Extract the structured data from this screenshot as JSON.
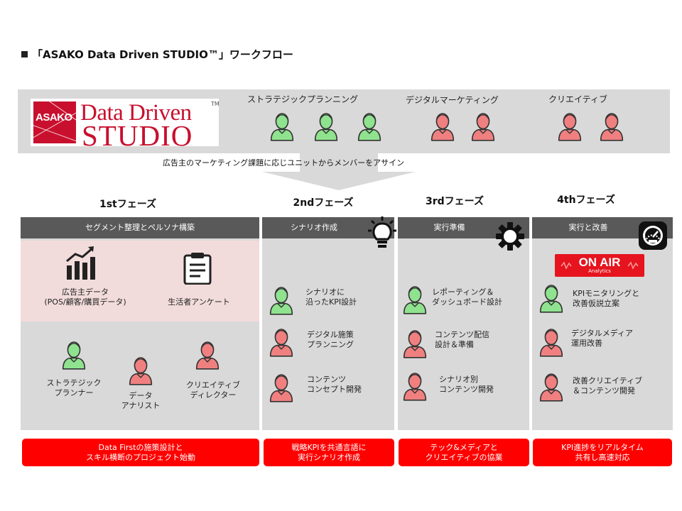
{
  "title": "「ASAKO Data Driven STUDIO™」ワークフロー",
  "logo": {
    "mark": "ASAKO",
    "line1": "Data Driven",
    "line2": "STUDIO",
    "tm": "TM"
  },
  "units": [
    {
      "label": "ストラテジックプランニング"
    },
    {
      "label": "デジタルマーケティング"
    },
    {
      "label": "クリエイティブ"
    }
  ],
  "assign_text": "広告主のマーケティング課題に応じユニットからメンバーをアサイン",
  "colors": {
    "green": "#8fe38f",
    "red": "#f08080",
    "header": "#595959",
    "panel": "#d9d9d9",
    "pink": "#f2dcdb",
    "accent": "#ff0000"
  },
  "phases": [
    {
      "name": "1stフェーズ",
      "header": "セグメント整理とペルソナ構築",
      "data_sources": [
        {
          "line1": "広告主データ",
          "line2": "(POS/顧客/購買データ)",
          "icon": "chart-icon"
        },
        {
          "line1": "生活者アンケート",
          "line2": "",
          "icon": "clipboard-icon"
        }
      ],
      "members": [
        {
          "line1": "ストラテジック",
          "line2": "プランナー",
          "color": "green"
        },
        {
          "line1": "データ",
          "line2": "アナリスト",
          "color": "red"
        },
        {
          "line1": "クリエイティブ",
          "line2": "ディレクター",
          "color": "red"
        }
      ],
      "footer": {
        "line1": "Data Firstの施策設計と",
        "line2": "スキル横断のプロジェクト始動"
      }
    },
    {
      "name": "2ndフェーズ",
      "header": "シナリオ作成",
      "icon": "lightbulb-icon",
      "tasks": [
        {
          "line1": "シナリオに",
          "line2": "沿ったKPI設計",
          "color": "green"
        },
        {
          "line1": "デジタル施策",
          "line2": "プランニング",
          "color": "red"
        },
        {
          "line1": "コンテンツ",
          "line2": "コンセプト開発",
          "color": "red"
        }
      ],
      "footer": {
        "line1": "戦略KPIを共通言語に",
        "line2": "実行シナリオ作成"
      }
    },
    {
      "name": "3rdフェーズ",
      "header": "実行準備",
      "icon": "gear-icon",
      "tasks": [
        {
          "line1": "レポーティング＆",
          "line2": "ダッシュボード設計",
          "color": "green"
        },
        {
          "line1": "コンテンツ配信",
          "line2": "設計＆準備",
          "color": "red"
        },
        {
          "line1": "シナリオ別",
          "line2": "コンテンツ開発",
          "color": "red"
        }
      ],
      "footer": {
        "line1": "テック&メディアと",
        "line2": "クリエイティブの協業"
      }
    },
    {
      "name": "4thフェーズ",
      "header": "実行と改善",
      "icon": "speedometer-icon",
      "badge": {
        "main": "ON AIR",
        "sub": "Analytics"
      },
      "tasks": [
        {
          "line1": "KPIモニタリングと",
          "line2": "改善仮説立案",
          "color": "green"
        },
        {
          "line1": "デジタルメディア",
          "line2": "運用改善",
          "color": "red"
        },
        {
          "line1": "改善クリエイティブ",
          "line2": "＆コンテンツ開発",
          "color": "red"
        }
      ],
      "footer": {
        "line1": "KPI進捗をリアルタイム",
        "line2": "共有し高速対応"
      }
    }
  ]
}
